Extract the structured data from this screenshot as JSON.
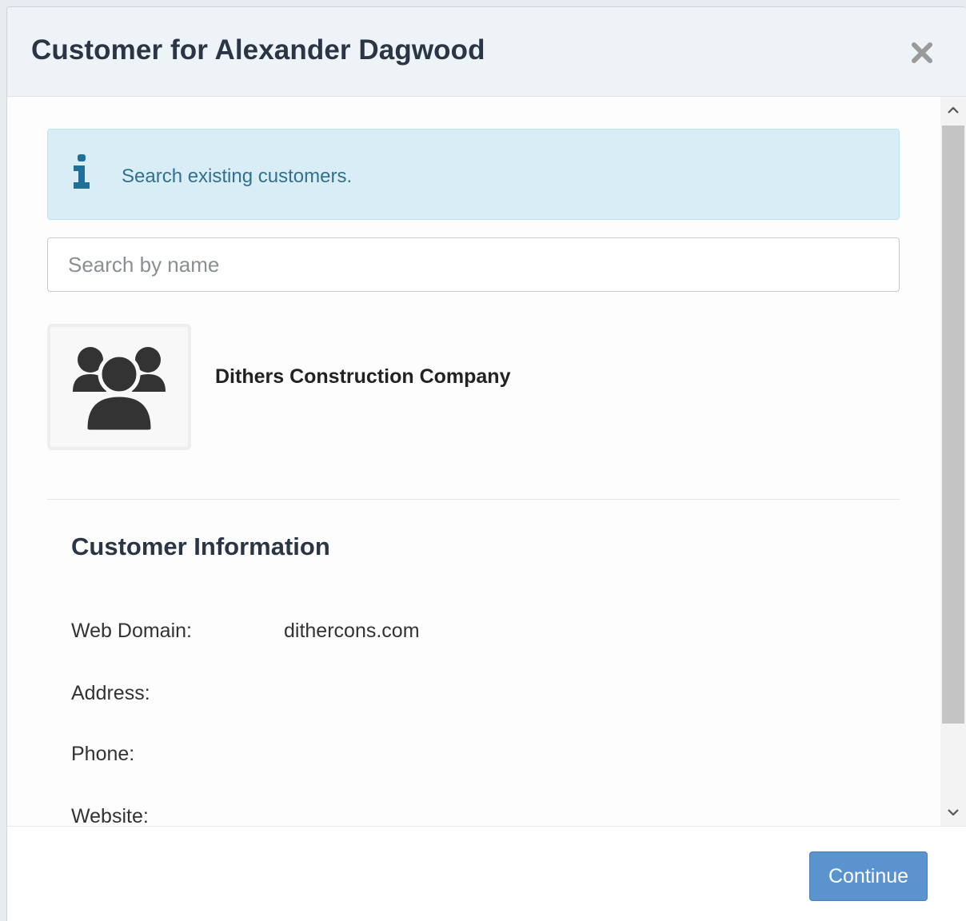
{
  "dialog": {
    "title": "Customer for Alexander Dagwood",
    "close_icon": "close-icon"
  },
  "alert": {
    "icon": "info-icon",
    "text": "Search existing customers."
  },
  "search": {
    "placeholder": "Search by name",
    "value": ""
  },
  "customer": {
    "avatar_icon": "users-group-icon",
    "name": "Dithers Construction Company"
  },
  "customer_info": {
    "title": "Customer Information",
    "rows": [
      {
        "label": "Web Domain:",
        "value": "dithercons.com"
      },
      {
        "label": "Address:",
        "value": ""
      },
      {
        "label": "Phone:",
        "value": ""
      },
      {
        "label": "Website:",
        "value": ""
      }
    ]
  },
  "footer": {
    "continue_label": "Continue"
  },
  "colors": {
    "header_bg": "#eef3f7",
    "alert_bg": "#d9edf7",
    "alert_text": "#31708f",
    "primary_button": "#5b93cf",
    "title_text": "#2a3545"
  }
}
